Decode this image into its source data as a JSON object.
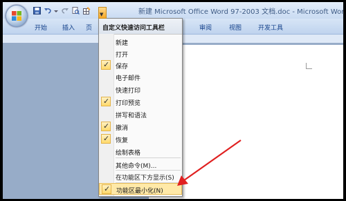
{
  "window": {
    "title": "新建 Microsoft Office Word 97-2003 文档.doc - Microsoft Word"
  },
  "quick_access": {
    "icons": [
      "save-icon",
      "undo-icon",
      "redo-icon",
      "print-preview-icon",
      "draw-table-icon"
    ]
  },
  "tabs": [
    {
      "label": "开始"
    },
    {
      "label": "插入"
    },
    {
      "label": "页"
    },
    {
      "label": "审阅"
    },
    {
      "label": "视图"
    },
    {
      "label": "开发工具"
    }
  ],
  "menu": {
    "header": "自定义快速访问工具栏",
    "items": [
      {
        "label": "新建",
        "checked": false
      },
      {
        "label": "打开",
        "checked": false
      },
      {
        "label": "保存",
        "checked": true
      },
      {
        "label": "电子邮件",
        "checked": false
      },
      {
        "label": "快速打印",
        "checked": false
      },
      {
        "label": "打印预览",
        "checked": true
      },
      {
        "label": "拼写和语法",
        "checked": false
      },
      {
        "label": "撤消",
        "checked": true
      },
      {
        "label": "恢复",
        "checked": true
      },
      {
        "label": "绘制表格",
        "checked": false
      },
      {
        "label": "其他命令(M)...",
        "checked": false
      },
      {
        "label": "在功能区下方显示(S)",
        "checked": false
      },
      {
        "label": "功能区最小化(N)",
        "checked": true
      }
    ]
  },
  "colors": {
    "accent": "#f6a828",
    "annotation_arrow": "#e02020"
  }
}
